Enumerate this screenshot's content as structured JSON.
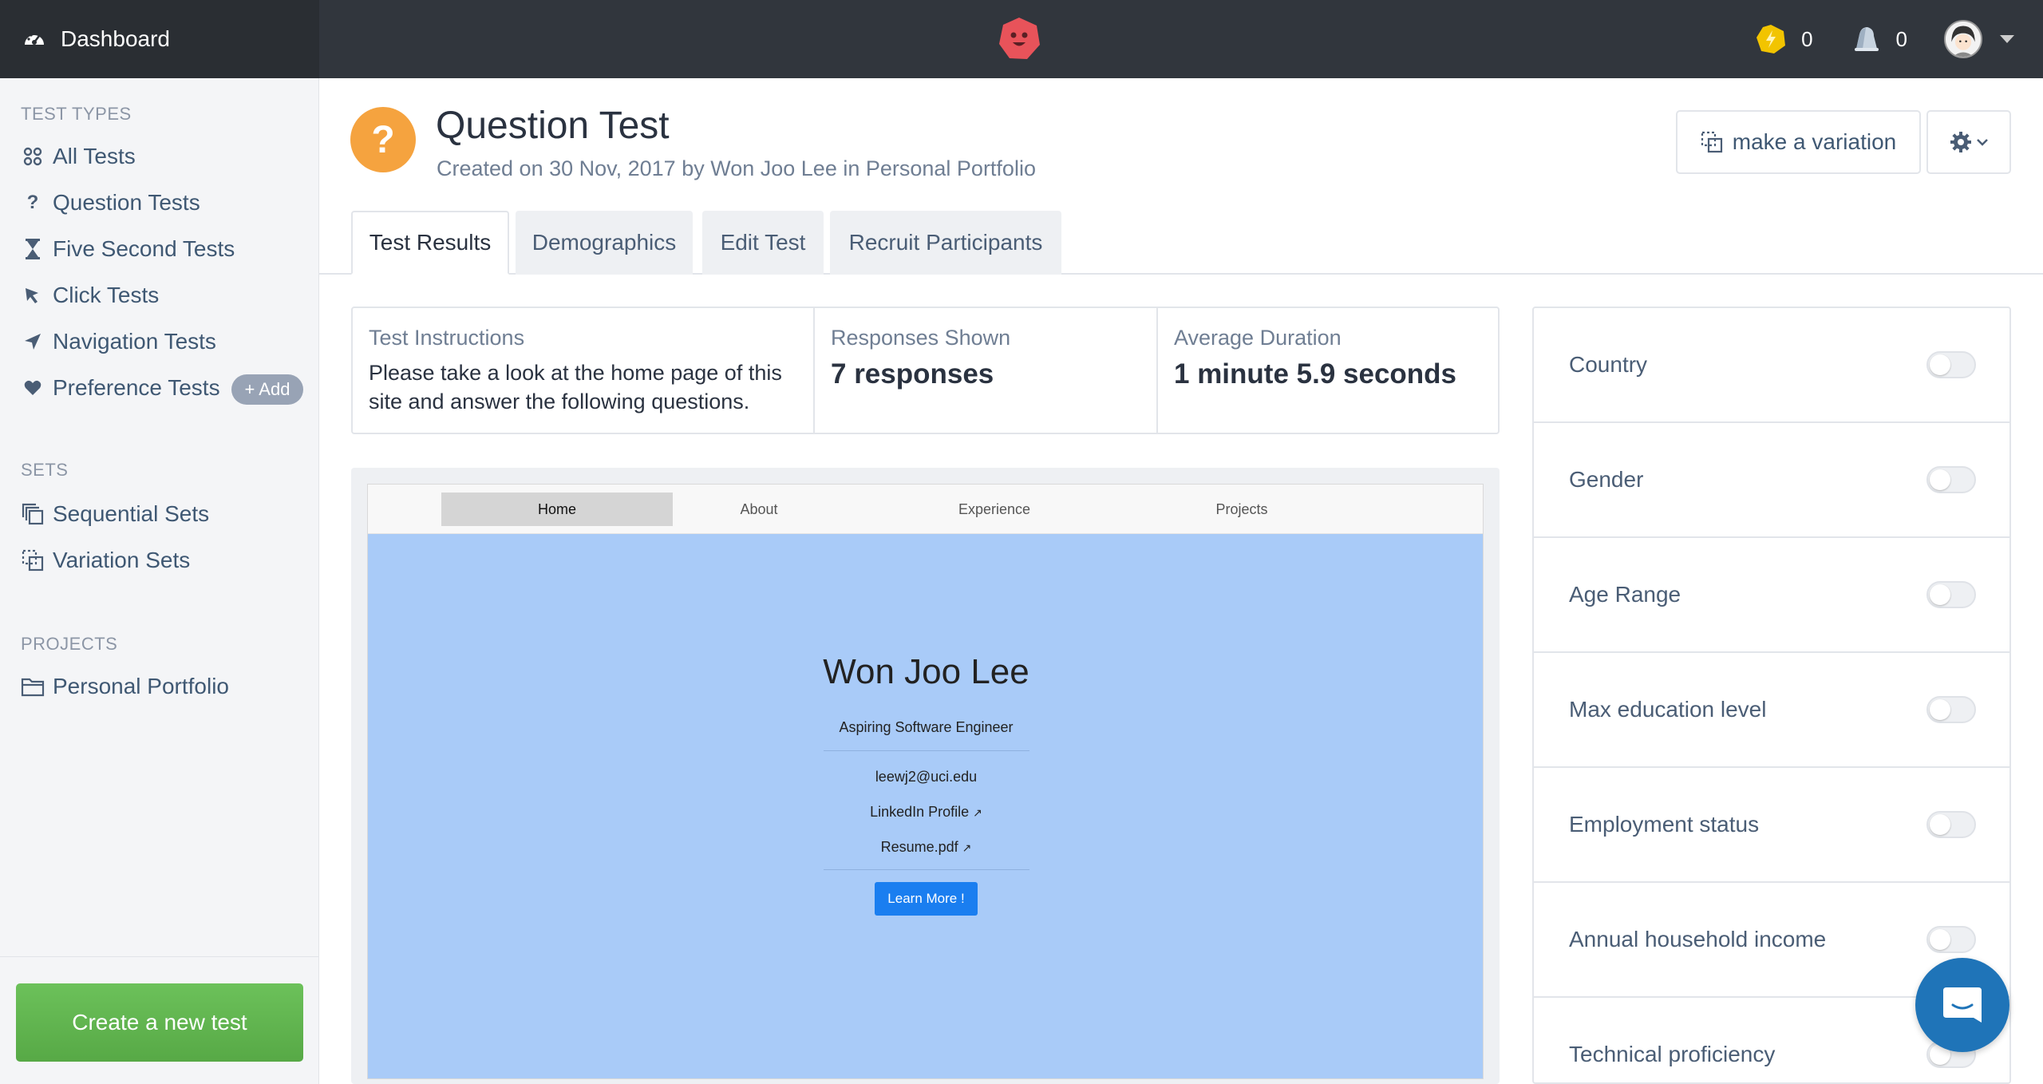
{
  "header": {
    "brand_label": "Dashboard",
    "credits_count": "0",
    "notifications_count": "0"
  },
  "sidebar": {
    "test_types_heading": "TEST TYPES",
    "test_types": [
      {
        "label": "All Tests",
        "icon": "all-tests-icon"
      },
      {
        "label": "Question Tests",
        "icon": "question-icon"
      },
      {
        "label": "Five Second Tests",
        "icon": "hourglass-icon"
      },
      {
        "label": "Click Tests",
        "icon": "cursor-icon"
      },
      {
        "label": "Navigation Tests",
        "icon": "navigation-arrow-icon"
      },
      {
        "label": "Preference Tests",
        "icon": "heart-icon"
      }
    ],
    "sets_heading": "SETS",
    "add_label": "+ Add",
    "sets": [
      {
        "label": "Sequential Sets",
        "icon": "sequential-sets-icon"
      },
      {
        "label": "Variation Sets",
        "icon": "variation-sets-icon"
      }
    ],
    "projects_heading": "PROJECTS",
    "projects": [
      {
        "label": "Personal Portfolio",
        "icon": "folder-icon"
      }
    ],
    "create_button_label": "Create a new test"
  },
  "page": {
    "badge": "?",
    "title": "Question Test",
    "subtitle": "Created on 30 Nov, 2017 by Won Joo Lee in Personal Portfolio",
    "variation_button_label": "make a variation"
  },
  "tabs": [
    {
      "label": "Test Results",
      "active": true
    },
    {
      "label": "Demographics",
      "active": false
    },
    {
      "label": "Edit Test",
      "active": false
    },
    {
      "label": "Recruit Participants",
      "active": false
    }
  ],
  "stats": {
    "instructions_label": "Test Instructions",
    "instructions_text": "Please take a look at the home page of this site and answer the following questions.",
    "responses_label": "Responses Shown",
    "responses_value": "7 responses",
    "duration_label": "Average Duration",
    "duration_value": "1 minute 5.9 seconds"
  },
  "preview": {
    "nav": [
      "Home",
      "About",
      "Experience",
      "Projects"
    ],
    "name": "Won Joo Lee",
    "role": "Aspiring Software Engineer",
    "email": "leewj2@uci.edu",
    "linkedin": "LinkedIn Profile",
    "resume": "Resume.pdf",
    "button": "Learn More !"
  },
  "filters": [
    {
      "label": "Country",
      "enabled": false
    },
    {
      "label": "Gender",
      "enabled": false
    },
    {
      "label": "Age Range",
      "enabled": false
    },
    {
      "label": "Max education level",
      "enabled": false
    },
    {
      "label": "Employment status",
      "enabled": false
    },
    {
      "label": "Annual household income",
      "enabled": false
    },
    {
      "label": "Technical proficiency",
      "enabled": false
    }
  ],
  "colors": {
    "topbar": "#31363d",
    "accent_orange": "#f5a33f",
    "create_green": "#5fb14e",
    "hero_blue": "#a9cbf8",
    "chat_blue": "#1f74b8"
  }
}
